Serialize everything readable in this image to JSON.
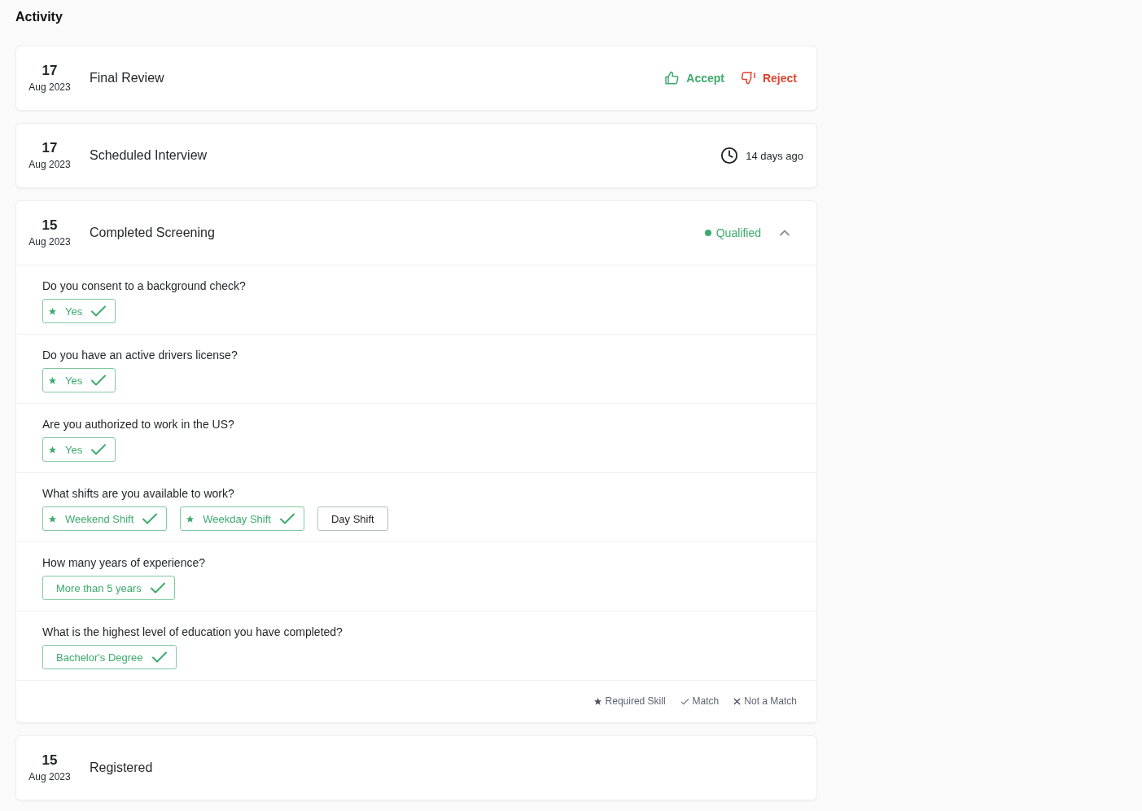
{
  "title": "Activity",
  "activities": [
    {
      "kind": "actions",
      "day": "17",
      "month": "Aug 2023",
      "title": "Final Review",
      "accept": "Accept",
      "reject": "Reject"
    },
    {
      "kind": "time",
      "day": "17",
      "month": "Aug 2023",
      "title": "Scheduled Interview",
      "time": "14 days ago"
    },
    {
      "kind": "status",
      "day": "15",
      "month": "Aug 2023",
      "title": "Completed Screening",
      "status": "Qualified",
      "color": "#3daa6e",
      "expanded": true,
      "questions": [
        {
          "text": "Do you consent to a background check?",
          "answers": [
            {
              "label": "Yes",
              "required": true,
              "match": true
            }
          ]
        },
        {
          "text": "Do you have an active drivers license?",
          "answers": [
            {
              "label": "Yes",
              "required": true,
              "match": true
            }
          ]
        },
        {
          "text": "Are you authorized to work in the US?",
          "answers": [
            {
              "label": "Yes",
              "required": true,
              "match": true
            }
          ]
        },
        {
          "text": "What shifts are you available to work?",
          "answers": [
            {
              "label": "Weekend Shift",
              "required": true,
              "match": true
            },
            {
              "label": "Weekday Shift",
              "required": true,
              "match": true
            },
            {
              "label": "Day Shift",
              "required": false,
              "match": false
            }
          ]
        },
        {
          "text": "How many years of experience?",
          "answers": [
            {
              "label": "More than 5 years",
              "required": false,
              "match": true
            }
          ]
        },
        {
          "text": "What is the highest level of education you have completed?",
          "answers": [
            {
              "label": "Bachelor's Degree",
              "required": false,
              "match": true
            }
          ]
        }
      ],
      "legend": [
        {
          "kind": "star",
          "label": "Required Skill"
        },
        {
          "kind": "check",
          "label": "Match"
        },
        {
          "kind": "cross",
          "label": "Not a Match"
        }
      ]
    },
    {
      "kind": "plain",
      "day": "15",
      "month": "Aug 2023",
      "title": "Registered"
    }
  ]
}
